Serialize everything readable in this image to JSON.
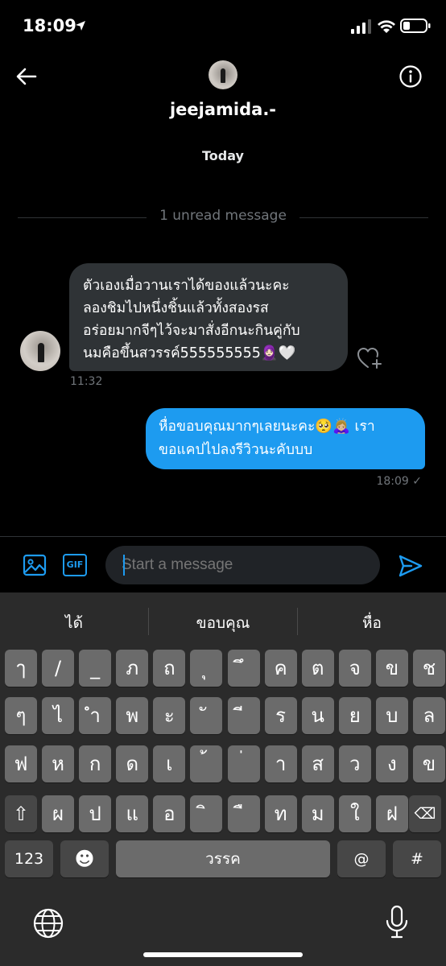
{
  "status_bar": {
    "time": "18:09",
    "icons": [
      "location-arrow",
      "cellular-signal",
      "wifi",
      "battery"
    ]
  },
  "header": {
    "name": "jeejamida.-",
    "back_icon": "arrow-left",
    "info_icon": "info-circle"
  },
  "conversation": {
    "date_label": "Today",
    "unread_divider": "1 unread message",
    "messages": [
      {
        "direction": "incoming",
        "lines": [
          "ตัวเองเมื่อวานเราได้ของแล้วนะคะ",
          "ลองชิมไปหนึ่งชิ้นแล้วทั้งสองรส",
          "อร่อยมากจีๆไว้จะมาสั่งอีกนะกินคู่กับ",
          "นมคือขึ้นสวรรค์555555555🧕🏻🤍"
        ],
        "time": "11:32"
      },
      {
        "direction": "outgoing",
        "lines": [
          "หื่อขอบคุณมากๆเลยนะคะ🥺🙇🏼‍♀️ เรา",
          "ขอแคปไปลงรีวิวนะคับบบ"
        ],
        "time": "18:09",
        "status": "✓"
      }
    ]
  },
  "composer": {
    "placeholder": "Start a message",
    "gif_label": "GIF",
    "accent_color": "#1d9bf0"
  },
  "keyboard": {
    "suggestions": [
      "ได้",
      "ขอบคุณ",
      "หื่อ"
    ],
    "rows": [
      [
        "ๅ",
        "/",
        "_",
        "ภ",
        "ถ",
        "ุ",
        "ึ",
        "ค",
        "ต",
        "จ",
        "ข",
        "ช"
      ],
      [
        "ๆ",
        "ไ",
        "ำ",
        "พ",
        "ะ",
        "ั",
        "ี",
        "ร",
        "น",
        "ย",
        "บ",
        "ล"
      ],
      [
        "ฟ",
        "ห",
        "ก",
        "ด",
        "เ",
        "้",
        "่",
        "า",
        "ส",
        "ว",
        "ง",
        "ข"
      ],
      [
        "ผ",
        "ป",
        "แ",
        "อ",
        "ิ",
        "ื",
        "ท",
        "ม",
        "ใ",
        "ฝ"
      ]
    ],
    "shift_label": "⇧",
    "delete_label": "⌫",
    "numbers_label": "123",
    "emoji_label": "☻",
    "space_label": "วรรค",
    "at_label": "@",
    "hash_label": "#"
  }
}
